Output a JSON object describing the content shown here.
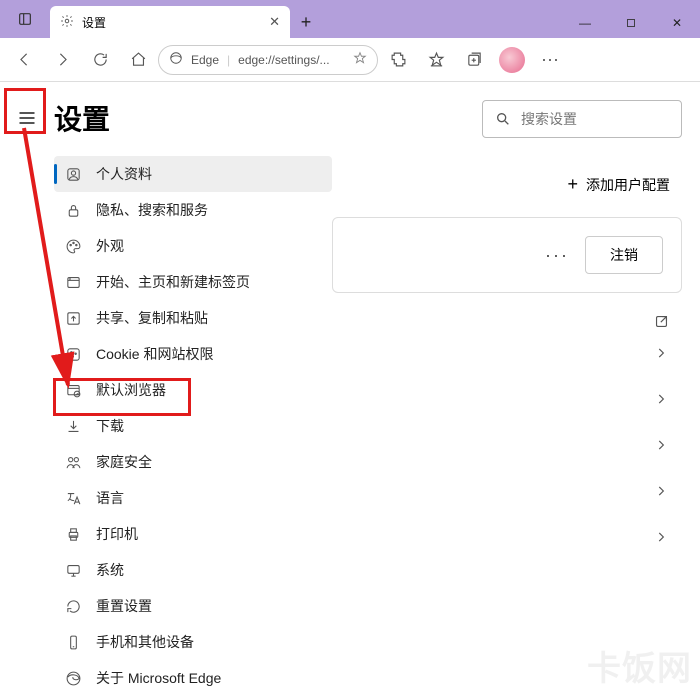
{
  "window": {
    "tab_title": "设置",
    "minimize": "—",
    "maximize": "□",
    "close": "✕",
    "newtab": "+"
  },
  "toolbar": {
    "edge_label": "Edge",
    "url": "edge://settings/..."
  },
  "page": {
    "title": "设置"
  },
  "nav": {
    "items": [
      {
        "label": "个人资料"
      },
      {
        "label": "隐私、搜索和服务"
      },
      {
        "label": "外观"
      },
      {
        "label": "开始、主页和新建标签页"
      },
      {
        "label": "共享、复制和粘贴"
      },
      {
        "label": "Cookie 和网站权限"
      },
      {
        "label": "默认浏览器"
      },
      {
        "label": "下载"
      },
      {
        "label": "家庭安全"
      },
      {
        "label": "语言"
      },
      {
        "label": "打印机"
      },
      {
        "label": "系统"
      },
      {
        "label": "重置设置"
      },
      {
        "label": "手机和其他设备"
      },
      {
        "label": "关于 Microsoft Edge"
      }
    ]
  },
  "main": {
    "search_placeholder": "搜索设置",
    "add_user": "添加用户配置",
    "logout": "注销",
    "more": "···"
  },
  "watermark": "卡饭网"
}
